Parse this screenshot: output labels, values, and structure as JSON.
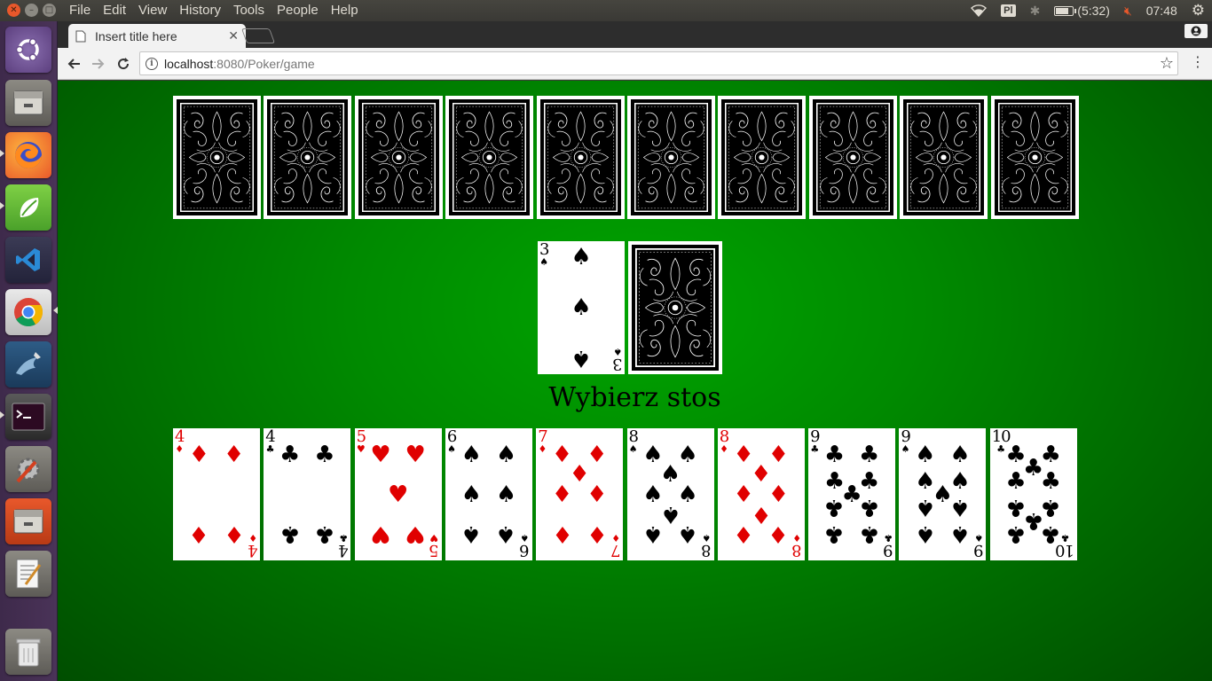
{
  "top_panel": {
    "menus": [
      "File",
      "Edit",
      "View",
      "History",
      "Tools",
      "People",
      "Help"
    ],
    "keyboard_layout": "Pl",
    "battery": "(5:32)",
    "battery_level": 0.8,
    "clock": "07:48"
  },
  "launcher": {
    "items": [
      "ubuntu-dash-icon",
      "files-icon",
      "firefox-icon",
      "spring-tool-suite-icon",
      "vscode-icon",
      "chrome-icon",
      "mysql-workbench-icon",
      "terminal-icon",
      "system-settings-icon",
      "files-icon-2",
      "text-editor-icon",
      "trash-icon"
    ]
  },
  "browser": {
    "tab_title": "Insert title here",
    "url_host": "localhost",
    "url_path": ":8080/Poker/game"
  },
  "game": {
    "prompt": "Wybierz stos",
    "top_row_face_down_count": 10,
    "discard_card": {
      "rank": "3",
      "suit": "♠",
      "color": "black"
    },
    "draw_pile_label": "card-back",
    "hand": [
      {
        "rank": "4",
        "suit": "♦",
        "color": "red"
      },
      {
        "rank": "4",
        "suit": "♣",
        "color": "black"
      },
      {
        "rank": "5",
        "suit": "♥",
        "color": "red"
      },
      {
        "rank": "6",
        "suit": "♠",
        "color": "black"
      },
      {
        "rank": "7",
        "suit": "♦",
        "color": "red"
      },
      {
        "rank": "8",
        "suit": "♠",
        "color": "black"
      },
      {
        "rank": "8",
        "suit": "♦",
        "color": "red"
      },
      {
        "rank": "9",
        "suit": "♣",
        "color": "black"
      },
      {
        "rank": "9",
        "suit": "♠",
        "color": "black"
      },
      {
        "rank": "10",
        "suit": "♣",
        "color": "black"
      }
    ],
    "colors": {
      "table_green": "#008a00",
      "red_suit": "#e00000"
    }
  }
}
